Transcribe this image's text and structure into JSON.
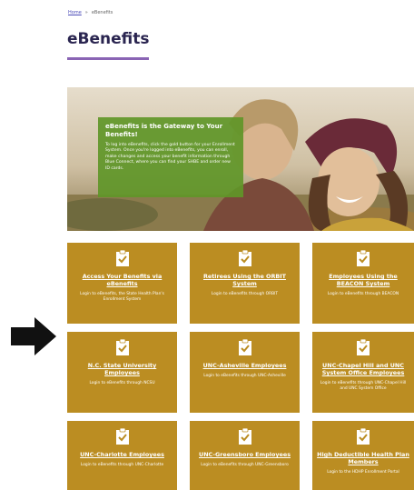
{
  "breadcrumb": {
    "home": "Home",
    "separator": "»",
    "current": "eBenefits"
  },
  "page": {
    "title": "eBenefits"
  },
  "hero": {
    "title": "eBenefits is the Gateway to Your Benefits!",
    "text": "To log into eBenefits, click the gold button for your Enrollment System. Once you're logged into eBenefits, you can enroll, make changes and access your benefit information through Blue Connect, where you can find your SHBE and order new ID cards."
  },
  "tiles": [
    {
      "title": "Access Your Benefits via eBenefits",
      "subtitle": "Login to eBenefits, the State Health Plan's Enrollment System"
    },
    {
      "title": "Retirees Using the ORBIT System",
      "subtitle": "Login to eBenefits through ORBIT"
    },
    {
      "title": "Employees Using the BEACON System",
      "subtitle": "Login to eBenefits through BEACON"
    },
    {
      "title": "N.C. State University Employees",
      "subtitle": "Login to eBenefits through NCSU"
    },
    {
      "title": "UNC-Asheville Employees",
      "subtitle": "Login to eBenefits through UNC-Asheville"
    },
    {
      "title": "UNC-Chapel Hill and UNC System Office Employees",
      "subtitle": "Login to eBenefits through UNC-Chapel Hill and UNC System Office"
    },
    {
      "title": "UNC-Charlotte Employees",
      "subtitle": "Login to eBenefits through UNC-Charlotte"
    },
    {
      "title": "UNC-Greensboro Employees",
      "subtitle": "Login to eBenefits through UNC-Greensboro"
    },
    {
      "title": "High Deductible Health Plan Members",
      "subtitle": "Login to the HDHP Enrollment Portal"
    }
  ],
  "colors": {
    "tile": "#bb8d22",
    "hero_box": "#609628",
    "title": "#2a2550",
    "underline": "#8a64b4"
  },
  "icons": {
    "tile": "clipboard-check-icon",
    "pointer": "arrow-right-icon"
  }
}
